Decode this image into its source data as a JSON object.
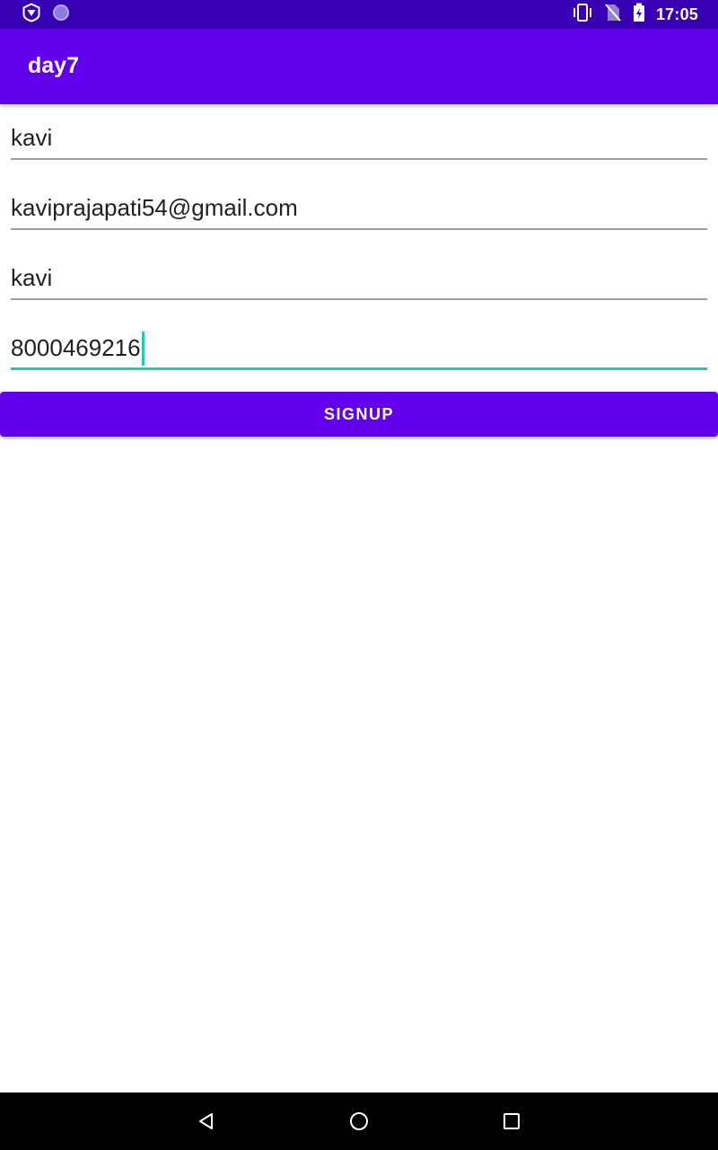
{
  "status_bar": {
    "time": "17:05",
    "left_icons": [
      "shield-notification-icon",
      "circle-notification-icon"
    ],
    "right_icons": [
      "vibrate-icon",
      "no-sim-icon",
      "battery-charging-icon"
    ]
  },
  "app_bar": {
    "title": "day7"
  },
  "form": {
    "fields": [
      {
        "value": "kavi"
      },
      {
        "value": "kaviprajapati54@gmail.com"
      },
      {
        "value": "kavi"
      },
      {
        "value": "8000469216"
      }
    ],
    "signup_label": "SIGNUP"
  },
  "nav_bar": {
    "icons": [
      "back-icon",
      "home-icon",
      "recents-icon"
    ]
  },
  "colors": {
    "status_bar": "#3700b3",
    "primary": "#6200ee",
    "focus_accent": "#26c6b8",
    "underline": "#9e9e9e",
    "text": "#212121"
  }
}
